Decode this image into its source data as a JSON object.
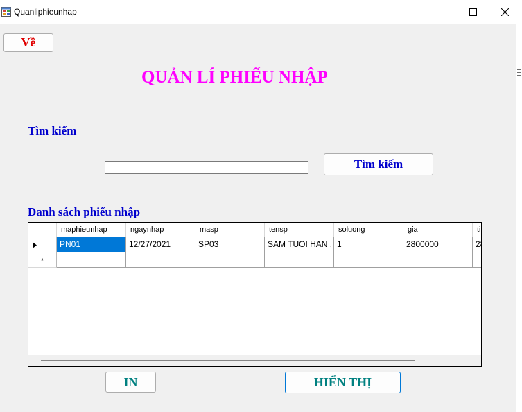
{
  "window": {
    "title": "Quanliphieunhap",
    "controls": [
      "minimize-icon",
      "maximize-icon",
      "close-icon"
    ]
  },
  "back_button": {
    "label": "Về",
    "color": "#e00000"
  },
  "page_title": {
    "text": "QUẢN LÍ PHIẾU NHẬP",
    "color": "#ff00ff"
  },
  "search": {
    "heading": "Tìm kiếm",
    "input_value": "",
    "button_label": "Tìm kiếm"
  },
  "list": {
    "heading": "Danh sách phiếu nhập",
    "columns": [
      "maphieunhap",
      "ngaynhap",
      "masp",
      "tensp",
      "soluong",
      "gia",
      "ti"
    ],
    "rows": [
      [
        "PN01",
        "12/27/2021",
        "SP03",
        "SAM TUOI HAN ...",
        "1",
        "2800000",
        "28"
      ]
    ],
    "new_row_marker": "*"
  },
  "footer": {
    "print_label": "IN",
    "show_label": "HIỂN THỊ"
  },
  "colors": {
    "heading_blue": "#0000cd",
    "teal": "#008080",
    "selection": "#0078d7"
  }
}
